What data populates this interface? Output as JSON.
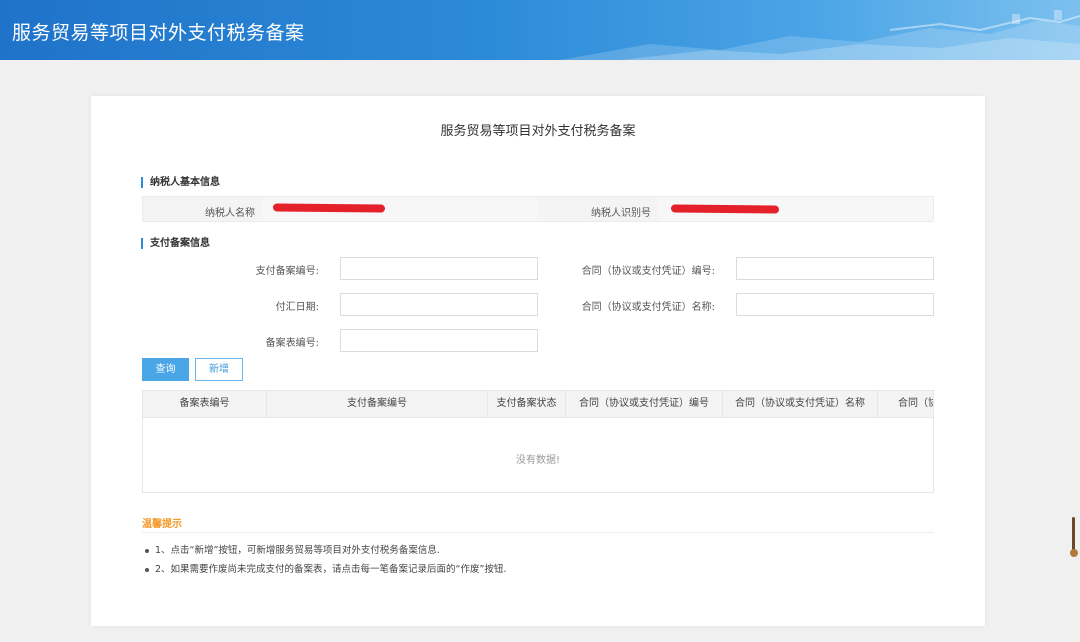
{
  "header": {
    "title": "服务贸易等项目对外支付税务备案"
  },
  "page": {
    "title": "服务贸易等项目对外支付税务备案"
  },
  "taxpayer_section": {
    "title": "纳税人基本信息",
    "name_label": "纳税人名称",
    "id_label": "纳税人识别号"
  },
  "payment_section": {
    "title": "支付备案信息",
    "fields": {
      "payment_filing_no": {
        "label": "支付备案编号:",
        "value": ""
      },
      "contract_no": {
        "label": "合同（协议或支付凭证）编号:",
        "value": ""
      },
      "remit_date": {
        "label": "付汇日期:",
        "value": ""
      },
      "contract_name": {
        "label": "合同（协议或支付凭证）名称:",
        "value": ""
      },
      "filing_form_no": {
        "label": "备案表编号:",
        "value": ""
      }
    }
  },
  "buttons": {
    "query": "查询",
    "add": "新增"
  },
  "table": {
    "columns": [
      "备案表编号",
      "支付备案编号",
      "支付备案状态",
      "合同（协议或支付凭证）编号",
      "合同（协议或支付凭证）名称",
      "合同（协"
    ],
    "empty_text": "没有数据!"
  },
  "tips": {
    "title": "温馨提示",
    "items": [
      "1、点击“新增”按钮，可新增服务贸易等项目对外支付税务备案信息.",
      "2、如果需要作废尚未完成支付的备案表，请点击每一笔备案记录后面的“作废”按钮."
    ]
  },
  "colors": {
    "accent": "#2d8ad8",
    "tips_title": "#f39a2b",
    "redaction": "#e4202a"
  }
}
